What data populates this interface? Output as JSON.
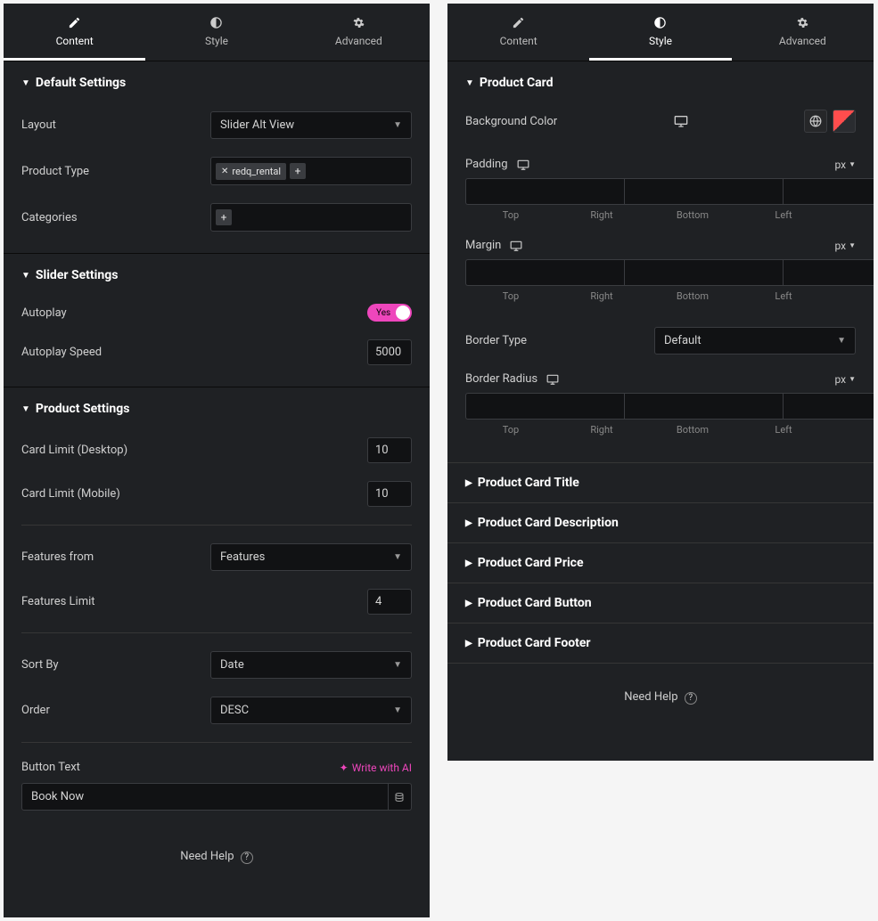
{
  "tabs": {
    "content": "Content",
    "style": "Style",
    "advanced": "Advanced"
  },
  "left": {
    "sections": {
      "default_settings": "Default Settings",
      "slider_settings": "Slider Settings",
      "product_settings": "Product Settings"
    },
    "controls": {
      "layout_label": "Layout",
      "layout_value": "Slider Alt View",
      "product_type_label": "Product Type",
      "product_type_tag": "redq_rental",
      "categories_label": "Categories",
      "autoplay_label": "Autoplay",
      "autoplay_value": "Yes",
      "autoplay_speed_label": "Autoplay Speed",
      "autoplay_speed_value": "5000",
      "card_limit_desktop_label": "Card Limit (Desktop)",
      "card_limit_desktop_value": "10",
      "card_limit_mobile_label": "Card Limit (Mobile)",
      "card_limit_mobile_value": "10",
      "features_from_label": "Features from",
      "features_from_value": "Features",
      "features_limit_label": "Features Limit",
      "features_limit_value": "4",
      "sort_by_label": "Sort By",
      "sort_by_value": "Date",
      "order_label": "Order",
      "order_value": "DESC",
      "button_text_label": "Button Text",
      "write_with_ai": "Write with AI",
      "button_text_value": "Book Now"
    },
    "footer": {
      "need_help": "Need Help",
      "q": "?"
    }
  },
  "right": {
    "sections": {
      "product_card": "Product Card",
      "product_card_title": "Product Card Title",
      "product_card_description": "Product Card Description",
      "product_card_price": "Product Card Price",
      "product_card_button": "Product Card Button",
      "product_card_footer": "Product Card Footer"
    },
    "controls": {
      "background_color_label": "Background Color",
      "padding_label": "Padding",
      "margin_label": "Margin",
      "border_type_label": "Border Type",
      "border_type_value": "Default",
      "border_radius_label": "Border Radius",
      "unit_px": "px",
      "dim_top": "Top",
      "dim_right": "Right",
      "dim_bottom": "Bottom",
      "dim_left": "Left"
    },
    "footer": {
      "need_help": "Need Help",
      "q": "?"
    }
  }
}
